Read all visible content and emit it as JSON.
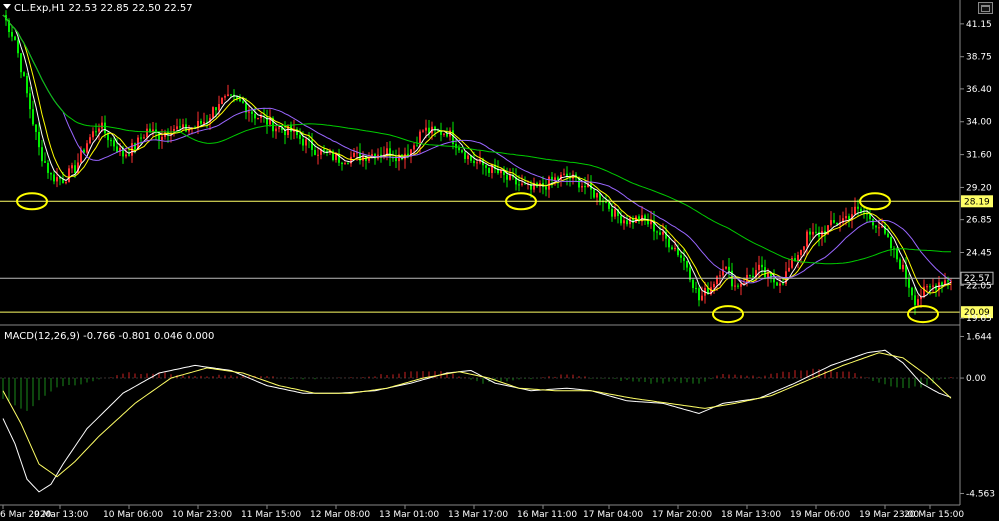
{
  "header": {
    "symbol_line": "CL.Exp,H1  22.53 22.85 22.50 22.57",
    "dropdown_icon": "triangle-down-icon"
  },
  "macd_header": "MACD(12,26,9) -0.766 -0.801 0.046 0.000",
  "price_axis": {
    "ticks": [
      "41.15",
      "38.75",
      "36.40",
      "34.00",
      "31.60",
      "29.20",
      "26.85",
      "24.45",
      "22.05",
      "19.65"
    ]
  },
  "macd_axis": {
    "ticks": [
      "1.644",
      "0.00",
      "-4.563"
    ]
  },
  "x_axis": {
    "ticks": [
      "6 Mar 2020",
      "9 Mar 13:00",
      "10 Mar 06:00",
      "10 Mar 23:00",
      "11 Mar 15:00",
      "12 Mar 08:00",
      "13 Mar 01:00",
      "13 Mar 17:00",
      "16 Mar 11:00",
      "17 Mar 04:00",
      "17 Mar 20:00",
      "18 Mar 13:00",
      "19 Mar 06:00",
      "19 Mar 23:00",
      "20 Mar 15:00"
    ]
  },
  "levels": {
    "resistance": "28.19",
    "current": "22.57",
    "support": "20.09"
  },
  "colors": {
    "bull": "#ff3030",
    "bear": "#00ee00",
    "level": "#ffff66",
    "fast_ma": "#ffffff",
    "mid_ma": "#ffff00",
    "slow_ma": "#9966ff",
    "long_ma": "#00cc00",
    "macd_up": "#cc2222",
    "macd_dn": "#1a8a1a"
  },
  "chart_data": [
    {
      "type": "candlestick",
      "title": "CL.Exp,H1",
      "timeframe": "H1",
      "ohlc_last": {
        "open": 22.53,
        "high": 22.85,
        "low": 22.5,
        "close": 22.57
      },
      "ylim": [
        19.3,
        42.6
      ],
      "x_ticks": [
        "6 Mar 2020",
        "9 Mar 13:00",
        "10 Mar 06:00",
        "10 Mar 23:00",
        "11 Mar 15:00",
        "12 Mar 08:00",
        "13 Mar 01:00",
        "13 Mar 17:00",
        "16 Mar 11:00",
        "17 Mar 04:00",
        "17 Mar 20:00",
        "18 Mar 13:00",
        "19 Mar 06:00",
        "19 Mar 23:00",
        "20 Mar 15:00"
      ],
      "y_ticks": [
        41.15,
        38.75,
        36.4,
        34.0,
        31.6,
        29.2,
        26.85,
        24.45,
        22.05,
        19.65
      ],
      "horizontal_lines": [
        28.19,
        22.57,
        20.09
      ],
      "close_path": [
        [
          0,
          41.8
        ],
        [
          4,
          40
        ],
        [
          8,
          36
        ],
        [
          12,
          32
        ],
        [
          16,
          30
        ],
        [
          20,
          29.8
        ],
        [
          24,
          30.6
        ],
        [
          28,
          32.5
        ],
        [
          32,
          33.8
        ],
        [
          36,
          32.6
        ],
        [
          40,
          31.6
        ],
        [
          44,
          32.2
        ],
        [
          48,
          33.4
        ],
        [
          52,
          33.0
        ],
        [
          56,
          33.6
        ],
        [
          60,
          33.4
        ],
        [
          64,
          33.6
        ],
        [
          68,
          34.2
        ],
        [
          72,
          35.5
        ],
        [
          76,
          35.6
        ],
        [
          80,
          35.3
        ],
        [
          84,
          34.5
        ],
        [
          88,
          34.0
        ],
        [
          92,
          33.5
        ],
        [
          96,
          33.3
        ],
        [
          100,
          32.6
        ],
        [
          104,
          32.0
        ],
        [
          108,
          31.6
        ],
        [
          112,
          31.3
        ],
        [
          116,
          31.4
        ],
        [
          120,
          31.5
        ],
        [
          124,
          31.7
        ],
        [
          128,
          31.8
        ],
        [
          132,
          31.5
        ],
        [
          136,
          32.0
        ],
        [
          140,
          33.4
        ],
        [
          144,
          33.2
        ],
        [
          148,
          33.3
        ],
        [
          152,
          32.2
        ],
        [
          156,
          31.2
        ],
        [
          160,
          30.8
        ],
        [
          164,
          30.4
        ],
        [
          168,
          29.8
        ],
        [
          172,
          29.4
        ],
        [
          176,
          29.0
        ],
        [
          180,
          29.3
        ],
        [
          184,
          29.8
        ],
        [
          188,
          30.0
        ],
        [
          192,
          29.6
        ],
        [
          196,
          28.9
        ],
        [
          200,
          28.4
        ],
        [
          204,
          27.2
        ],
        [
          208,
          26.8
        ],
        [
          212,
          26.9
        ],
        [
          216,
          26.5
        ],
        [
          220,
          25.6
        ],
        [
          224,
          24.8
        ],
        [
          228,
          23.5
        ],
        [
          232,
          21.0
        ],
        [
          236,
          22.0
        ],
        [
          240,
          23.6
        ],
        [
          244,
          22.0
        ],
        [
          248,
          22.6
        ],
        [
          252,
          23.2
        ],
        [
          256,
          22.3
        ],
        [
          260,
          22.5
        ],
        [
          264,
          24.0
        ],
        [
          268,
          25.6
        ],
        [
          272,
          25.8
        ],
        [
          276,
          26.4
        ],
        [
          280,
          26.9
        ],
        [
          284,
          27.5
        ],
        [
          288,
          27.2
        ],
        [
          292,
          26.4
        ],
        [
          296,
          24.8
        ],
        [
          300,
          23.2
        ],
        [
          304,
          21.0
        ],
        [
          308,
          21.7
        ],
        [
          312,
          22.3
        ],
        [
          316,
          22.57
        ]
      ],
      "ma_series": [
        "fast (white)",
        "medium (yellow)",
        "slow (purple)",
        "long (green)"
      ]
    },
    {
      "type": "histogram+line",
      "title": "MACD(12,26,9)",
      "values_shown": {
        "macd": -0.766,
        "signal": -0.801,
        "histogram": 0.046,
        "zero": 0.0
      },
      "ylim": [
        -4.9,
        1.9
      ],
      "y_ticks": [
        1.644,
        0.0,
        -4.563
      ],
      "macd_line": [
        [
          0,
          -1.6
        ],
        [
          4,
          -2.6
        ],
        [
          8,
          -4.0
        ],
        [
          12,
          -4.5
        ],
        [
          16,
          -4.2
        ],
        [
          20,
          -3.4
        ],
        [
          28,
          -2.0
        ],
        [
          40,
          -0.6
        ],
        [
          52,
          0.2
        ],
        [
          64,
          0.5
        ],
        [
          76,
          0.3
        ],
        [
          88,
          -0.3
        ],
        [
          100,
          -0.6
        ],
        [
          112,
          -0.6
        ],
        [
          124,
          -0.5
        ],
        [
          136,
          -0.2
        ],
        [
          148,
          0.2
        ],
        [
          156,
          0.3
        ],
        [
          164,
          -0.2
        ],
        [
          176,
          -0.5
        ],
        [
          188,
          -0.4
        ],
        [
          196,
          -0.5
        ],
        [
          208,
          -0.9
        ],
        [
          220,
          -1.0
        ],
        [
          232,
          -1.4
        ],
        [
          240,
          -1.0
        ],
        [
          252,
          -0.8
        ],
        [
          264,
          -0.2
        ],
        [
          276,
          0.5
        ],
        [
          288,
          1.0
        ],
        [
          294,
          1.1
        ],
        [
          300,
          0.6
        ],
        [
          306,
          -0.2
        ],
        [
          312,
          -0.6
        ],
        [
          316,
          -0.76
        ]
      ],
      "signal_line": [
        [
          0,
          -0.5
        ],
        [
          6,
          -1.8
        ],
        [
          12,
          -3.4
        ],
        [
          18,
          -3.9
        ],
        [
          24,
          -3.3
        ],
        [
          32,
          -2.3
        ],
        [
          44,
          -1.0
        ],
        [
          56,
          0.0
        ],
        [
          68,
          0.4
        ],
        [
          80,
          0.2
        ],
        [
          92,
          -0.3
        ],
        [
          104,
          -0.6
        ],
        [
          116,
          -0.6
        ],
        [
          128,
          -0.4
        ],
        [
          140,
          0.0
        ],
        [
          152,
          0.25
        ],
        [
          162,
          0.0
        ],
        [
          172,
          -0.4
        ],
        [
          184,
          -0.5
        ],
        [
          196,
          -0.5
        ],
        [
          210,
          -0.8
        ],
        [
          222,
          -1.0
        ],
        [
          234,
          -1.2
        ],
        [
          244,
          -1.0
        ],
        [
          256,
          -0.7
        ],
        [
          268,
          -0.1
        ],
        [
          280,
          0.5
        ],
        [
          292,
          1.0
        ],
        [
          300,
          0.8
        ],
        [
          308,
          0.1
        ],
        [
          316,
          -0.8
        ]
      ],
      "histogram": [
        [
          0,
          -0.8
        ],
        [
          4,
          -1.1
        ],
        [
          8,
          -1.3
        ],
        [
          12,
          -0.9
        ],
        [
          16,
          -0.5
        ],
        [
          20,
          -0.3
        ],
        [
          28,
          -0.2
        ],
        [
          40,
          0.2
        ],
        [
          52,
          0.2
        ],
        [
          64,
          0.1
        ],
        [
          76,
          0.1
        ],
        [
          88,
          0.05
        ],
        [
          100,
          -0.05
        ],
        [
          112,
          0.0
        ],
        [
          124,
          0.1
        ],
        [
          136,
          0.25
        ],
        [
          144,
          0.3
        ],
        [
          152,
          0.1
        ],
        [
          160,
          -0.2
        ],
        [
          168,
          -0.1
        ],
        [
          176,
          -0.05
        ],
        [
          188,
          0.15
        ],
        [
          196,
          0.0
        ],
        [
          208,
          -0.1
        ],
        [
          216,
          -0.2
        ],
        [
          224,
          -0.15
        ],
        [
          232,
          -0.2
        ],
        [
          240,
          0.15
        ],
        [
          252,
          0.05
        ],
        [
          264,
          0.3
        ],
        [
          270,
          0.35
        ],
        [
          276,
          0.3
        ],
        [
          284,
          0.2
        ],
        [
          292,
          -0.2
        ],
        [
          300,
          -0.4
        ],
        [
          306,
          -0.35
        ],
        [
          312,
          -0.1
        ],
        [
          316,
          0.05
        ]
      ]
    }
  ]
}
